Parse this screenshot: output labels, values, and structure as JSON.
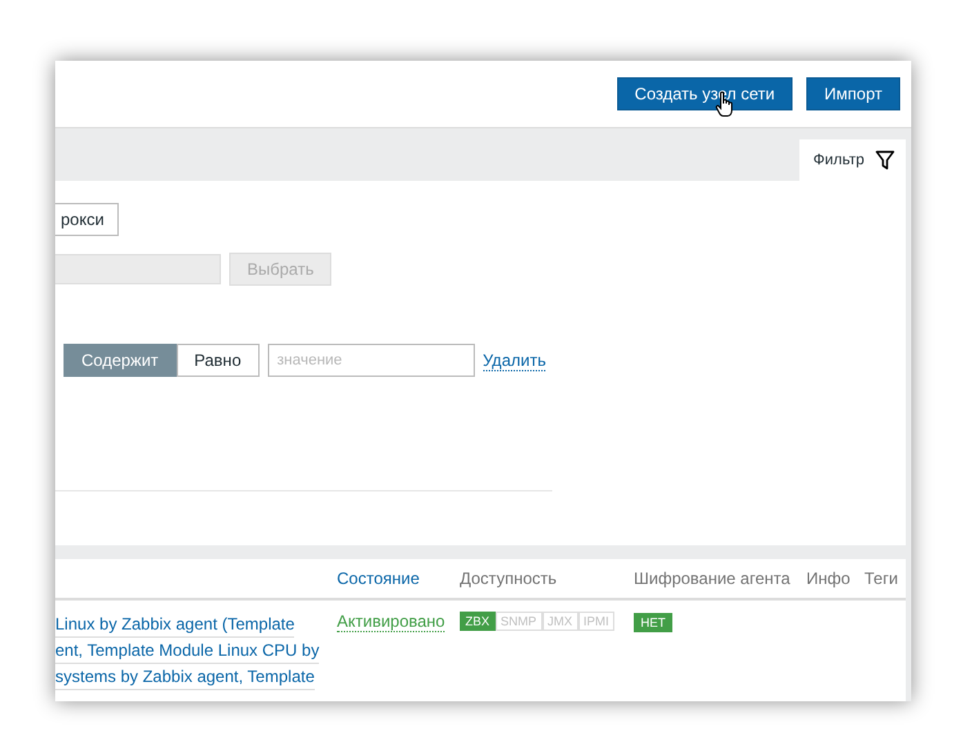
{
  "header": {
    "buttons": [
      {
        "label": "Создать узел сети",
        "kind": "primary"
      },
      {
        "label": "Импорт",
        "kind": "primary"
      }
    ]
  },
  "filter_tab": {
    "label": "Фильтр",
    "selected": true
  },
  "filter": {
    "proxy_button": {
      "label": "рокси"
    },
    "host_field": {
      "disabled": true
    },
    "select_button": {
      "label": "Выбрать",
      "disabled": true
    },
    "tag_operators": [
      {
        "label": "Содержит",
        "selected": true
      },
      {
        "label": "Равно",
        "selected": false
      }
    ],
    "tag_value": {
      "placeholder": "значение"
    },
    "remove_link": "Удалить"
  },
  "table": {
    "columns": [
      {
        "label": "Состояние",
        "sortable": true
      },
      {
        "label": "Доступность",
        "sortable": false
      },
      {
        "label": "Шифрование агента",
        "sortable": false
      },
      {
        "label": "Инфо",
        "sortable": false
      },
      {
        "label": "Теги",
        "sortable": false
      }
    ],
    "rows": [
      {
        "templates": [
          "Linux by Zabbix agent (Template",
          "ent, Template Module Linux CPU by",
          "systems by Zabbix agent, Template"
        ],
        "status": {
          "label": "Активировано",
          "enabled": true
        },
        "availability": [
          {
            "label": "ZBX",
            "on": true
          },
          {
            "label": "SNMP",
            "on": false
          },
          {
            "label": "JMX",
            "on": false
          },
          {
            "label": "IPMI",
            "on": false
          }
        ],
        "encryption": "НЕТ"
      }
    ]
  }
}
